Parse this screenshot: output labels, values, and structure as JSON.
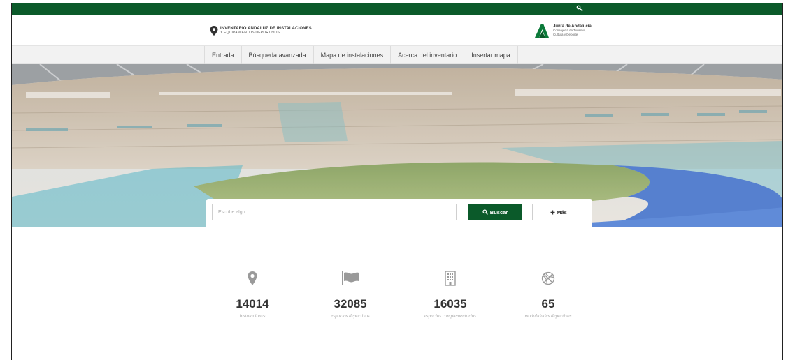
{
  "brand": {
    "line1": "INVENTARIO ANDALUZ DE INSTALACIONES",
    "line2": "Y EQUIPAMIENTOS DEPORTIVOS"
  },
  "junta": {
    "line1": "Junta de Andalucía",
    "line2": "Consejería de Turismo,",
    "line3": "Cultura y Deporte"
  },
  "nav": {
    "items": [
      {
        "label": "Entrada"
      },
      {
        "label": "Búsqueda avanzada"
      },
      {
        "label": "Mapa de instalaciones"
      },
      {
        "label": "Acerca del inventario"
      },
      {
        "label": "Insertar mapa"
      }
    ]
  },
  "search": {
    "placeholder": "Escribe algo...",
    "value": "",
    "search_label": "Buscar",
    "more_label": "Más"
  },
  "stats": [
    {
      "icon": "map-marker-icon",
      "value": "14014",
      "label": "instalaciones"
    },
    {
      "icon": "flag-icon",
      "value": "32085",
      "label": "espacios deportivos"
    },
    {
      "icon": "building-icon",
      "value": "16035",
      "label": "espacios complementarios"
    },
    {
      "icon": "basketball-icon",
      "value": "65",
      "label": "modalidades deportivas"
    }
  ],
  "colors": {
    "brand_green": "#0b5a2a",
    "nav_bg": "#f2f2f2",
    "icon_gray": "#9a9a9a"
  }
}
